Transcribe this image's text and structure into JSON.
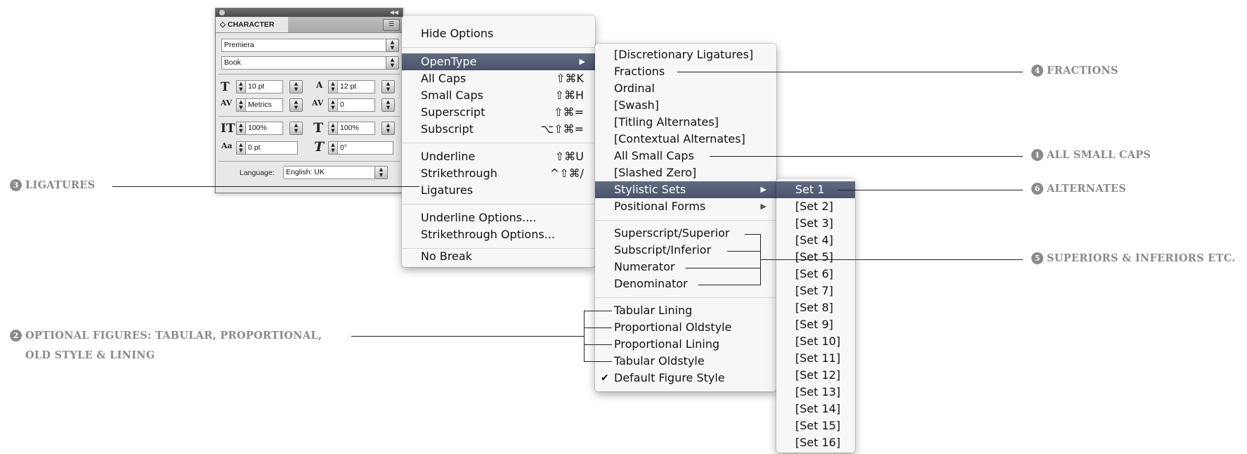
{
  "panel": {
    "tab_label": "◇ CHARACTER",
    "font_family": "Premiera",
    "font_style": "Book",
    "font_size": "10 pt",
    "leading": "12 pt",
    "kerning": "Metrics",
    "tracking": "0",
    "vertical_scale": "100%",
    "horizontal_scale": "100%",
    "baseline_shift": "0 pt",
    "skew": "0°",
    "language_label": "Language:",
    "language_value": "English: UK"
  },
  "main_menu": {
    "items": [
      {
        "label": "Hide Options",
        "shortcut": ""
      },
      {
        "label": "OpenType",
        "shortcut": "",
        "submenu": true,
        "highlighted": true
      },
      {
        "label": "All Caps",
        "shortcut": "⇧⌘K"
      },
      {
        "label": "Small Caps",
        "shortcut": "⇧⌘H"
      },
      {
        "label": "Superscript",
        "shortcut": "⇧⌘="
      },
      {
        "label": "Subscript",
        "shortcut": "⌥⇧⌘="
      },
      {
        "label": "Underline",
        "shortcut": "⇧⌘U"
      },
      {
        "label": "Strikethrough",
        "shortcut": "^⇧⌘/"
      },
      {
        "label": "Ligatures",
        "shortcut": ""
      },
      {
        "label": "Underline Options....",
        "shortcut": ""
      },
      {
        "label": "Strikethrough Options...",
        "shortcut": ""
      },
      {
        "label": "No Break",
        "shortcut": ""
      }
    ]
  },
  "opentype_menu": {
    "items": [
      {
        "label": "[Discretionary Ligatures]"
      },
      {
        "label": "Fractions"
      },
      {
        "label": "Ordinal"
      },
      {
        "label": "[Swash]"
      },
      {
        "label": "[Titling Alternates]"
      },
      {
        "label": "[Contextual Alternates]"
      },
      {
        "label": "All Small Caps"
      },
      {
        "label": "[Slashed Zero]"
      },
      {
        "label": "Stylistic Sets",
        "submenu": true,
        "highlighted": true
      },
      {
        "label": "Positional Forms",
        "submenu": true
      },
      {
        "label": "Superscript/Superior"
      },
      {
        "label": "Subscript/Inferior"
      },
      {
        "label": "Numerator"
      },
      {
        "label": "Denominator"
      },
      {
        "label": "Tabular Lining"
      },
      {
        "label": "Proportional Oldstyle"
      },
      {
        "label": "Proportional Lining"
      },
      {
        "label": "Tabular Oldstyle"
      },
      {
        "label": "Default Figure Style",
        "checked": true
      }
    ],
    "checkmark": "✔"
  },
  "stylistic_sets_menu": {
    "items": [
      "Set 1",
      "[Set 2]",
      "[Set 3]",
      "[Set 4]",
      "[Set 5]",
      "[Set 6]",
      "[Set 7]",
      "[Set 8]",
      "[Set 9]",
      "[Set 10]",
      "[Set 11]",
      "[Set 12]",
      "[Set 13]",
      "[Set 14]",
      "[Set 15]",
      "[Set 16]"
    ],
    "highlighted_index": 0
  },
  "annotations": {
    "a1": {
      "num": "1",
      "text": "ALL SMALL CAPS"
    },
    "a2": {
      "num": "2",
      "text_line1": "OPTIONAL FIGURES: TABULAR, PROPORTIONAL,",
      "text_line2": "OLD STYLE & LINING"
    },
    "a3": {
      "num": "3",
      "text": "LIGATURES"
    },
    "a4": {
      "num": "4",
      "text": "FRACTIONS"
    },
    "a5": {
      "num": "5",
      "text": "SUPERIORS & INFERIORS ETC."
    },
    "a6": {
      "num": "6",
      "text": "ALTERNATES"
    }
  },
  "colors": {
    "menu_highlight": "#4e586e",
    "annotation_text": "#8a8a8a",
    "leader_line": "#222222"
  },
  "icons": {
    "submenu_arrow": "▶",
    "panel_menu": "☰",
    "stepper": "▲▼"
  }
}
